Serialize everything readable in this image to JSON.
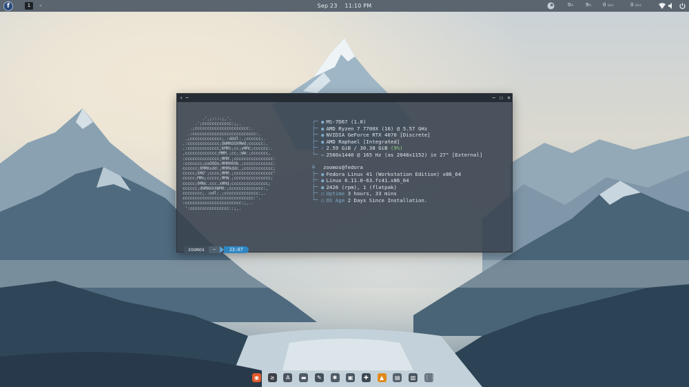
{
  "topbar": {
    "workspace": "1",
    "date": "Sep 23",
    "time": "11:10 PM",
    "tray": [
      {
        "value": "0",
        "unit": "%"
      },
      {
        "value": "9",
        "unit": "%"
      },
      {
        "value": "0",
        "unit": "kb/s"
      },
      {
        "value": "0",
        "unit": "kb/s"
      }
    ]
  },
  "terminal": {
    "title": "~",
    "ascii_art": [
      "        .',;::::;,'.",
      "     .';cccccccccccc:;,.",
      "   .;cccccccccccccccccccccc:.",
      "  .:cccccccccccccccccccccccccc:.",
      " .;ccccccccccccc;.:dddl:.;cccccc;.",
      ".:ccccccccccccc;OWMKOOXMWd;cccccc:.",
      ".:ccccccccccccc;KMMc;cc;xMMc;cccccc:.",
      ",ccccccccccccc;MMM.;cc;;WW:;ccccccc,",
      ":cccccccccccccc;MMM.;cccccccccccccccc:",
      ":ccccccc;oxOOOo;MMM000k.;cccccccccccc:",
      "cccccc;0MMKxdd:;MMMkddc.;cccccccccccc;",
      "ccccc;XMO';cccc;MMM.;cccccccccccccccc'",
      "ccccc;MMo;ccccc;MMW.;ccccccccccccccc;",
      "ccccc;0MNc.ccc.xMMd;ccccccccccccccc;",
      "cccccc;dNMWXXXWM0:;cccccccccccccc:,",
      "cccccccc;.:odl:.;cccccccccccccc:,.",
      "ccccccccccccccccccccccccccccc:'.",
      ":ccccccccccccccccccccccc:;,..",
      " ':cccccccccccccccc::;,."
    ],
    "hardware": [
      {
        "icon": "board",
        "text": "MS-7D67 (1.0)"
      },
      {
        "icon": "cpu",
        "text": "AMD Ryzen 7 7700X (16) @ 5.57 GHz"
      },
      {
        "icon": "gpu",
        "text": "NVIDIA GeForce RTX 4070 [Discrete]"
      },
      {
        "icon": "gpu",
        "text": "AMD Raphael [Integrated]"
      },
      {
        "icon": "memory",
        "text": "2.59 GiB / 30.38 GiB ",
        "extra": "(9%)"
      },
      {
        "icon": "display",
        "text": "2560x1440 @ 165 Hz (as 2048x1152) in 27\" [External]"
      }
    ],
    "software": [
      {
        "icon": "user",
        "text": "zoomos@fedora"
      },
      {
        "icon": "os",
        "text": "Fedora Linux 41 (Workstation Edition) x86_64"
      },
      {
        "icon": "kernel",
        "text": "Linux 6.11.0-63.fc41.x86_64"
      },
      {
        "icon": "packages",
        "text": "2426 (rpm), 1 (flatpak)"
      },
      {
        "icon": "uptime",
        "label": "Uptime",
        "text": " 3 hours, 33 mins"
      },
      {
        "icon": "os-age",
        "label": "OS Age",
        "text": " 2 Days Since Installation."
      }
    ],
    "prompt": {
      "user": "zoomos",
      "path": "~",
      "time": "23:07"
    }
  },
  "colors": {
    "accent": "#2f86c1",
    "topbar": "#5a6570",
    "terminal_bg": "#3a4450"
  },
  "dock": {
    "apps": [
      {
        "name": "firefox",
        "icon": "firefox-icon",
        "color": "#e05a2b"
      },
      {
        "name": "terminal",
        "icon": "terminal-icon",
        "color": "#3c4248"
      },
      {
        "name": "fonts",
        "icon": "font-viewer-icon",
        "color": "#4a5560"
      },
      {
        "name": "files",
        "icon": "folder-icon",
        "color": "#4f5b66"
      },
      {
        "name": "text-editor",
        "icon": "pencil-icon",
        "color": "#44505b"
      },
      {
        "name": "extensions",
        "icon": "puzzle-icon",
        "color": "#4f5c68"
      },
      {
        "name": "software",
        "icon": "store-icon",
        "color": "#4a5763"
      },
      {
        "name": "extension-manager",
        "icon": "extension-icon",
        "color": "#3d4a56"
      },
      {
        "name": "vlc",
        "icon": "cone-icon",
        "color": "#e08a1e"
      },
      {
        "name": "archive",
        "icon": "archive-icon",
        "color": "#56626d"
      },
      {
        "name": "trash",
        "icon": "trash-icon",
        "color": "#4a5560"
      },
      {
        "name": "show-apps",
        "icon": "grid-icon",
        "color": "#6b7782"
      }
    ]
  }
}
